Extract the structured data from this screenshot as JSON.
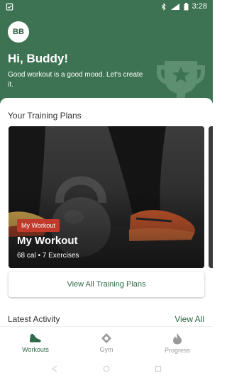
{
  "status_bar": {
    "time": "3:28",
    "icons": [
      "clipboard-check-icon",
      "bluetooth-icon",
      "signal-4g-icon",
      "battery-icon"
    ]
  },
  "header": {
    "avatar_initials": "BB",
    "greeting": "Hi, Buddy!",
    "subtitle": "Good workout is a good mood. Let's create it.",
    "decor_icon": "trophy-icon"
  },
  "training_plans": {
    "section_title": "Your Training Plans",
    "cards": [
      {
        "tag": "My Workout",
        "title": "My Workout",
        "meta": "68 cal • 7 Exercises"
      }
    ],
    "view_all_label": "View All Training Plans"
  },
  "latest_activity": {
    "title": "Latest Activity",
    "view_all_label": "View All"
  },
  "bottom_nav": {
    "items": [
      {
        "label": "Workouts",
        "icon": "shoe-icon",
        "active": true
      },
      {
        "label": "Gym",
        "icon": "location-icon",
        "active": false
      },
      {
        "label": "Progress",
        "icon": "flame-icon",
        "active": false
      }
    ]
  },
  "colors": {
    "brand_green": "#3d7352",
    "accent_green": "#2f6b48",
    "tag_red": "#c0392b",
    "inactive_gray": "#9a9a9a"
  }
}
